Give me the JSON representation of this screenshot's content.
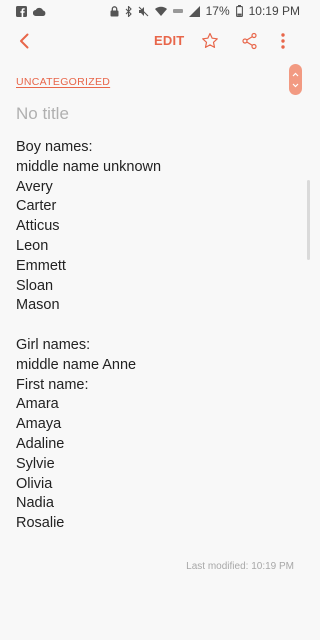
{
  "status_bar": {
    "battery": "17%",
    "time": "10:19 PM"
  },
  "toolbar": {
    "edit_label": "EDIT"
  },
  "note": {
    "category": "UNCATEGORIZED",
    "title_placeholder": "No title",
    "lines": [
      {
        "text": "Boy names:",
        "bold": true
      },
      {
        "text": "middle name unknown",
        "bold": true
      },
      {
        "text": "Avery",
        "bold": false
      },
      {
        "text": "Carter",
        "bold": false
      },
      {
        "text": "Atticus",
        "bold": false
      },
      {
        "text": "Leon",
        "bold": false
      },
      {
        "text": "Emmett",
        "bold": false
      },
      {
        "text": "Sloan",
        "bold": false
      },
      {
        "text": "Mason",
        "bold": false
      },
      {
        "text": "",
        "bold": false
      },
      {
        "text": "Girl names:",
        "bold": true
      },
      {
        "text": "middle name Anne",
        "bold": true
      },
      {
        "text": "First name:",
        "bold": true
      },
      {
        "text": "Amara",
        "bold": false
      },
      {
        "text": "Amaya",
        "bold": false
      },
      {
        "text": "Adaline",
        "bold": false
      },
      {
        "text": "Sylvie",
        "bold": false
      },
      {
        "text": "Olivia",
        "bold": false
      },
      {
        "text": "Nadia",
        "bold": false
      },
      {
        "text": "Rosalie",
        "bold": false
      }
    ],
    "last_modified": "Last modified: 10:19 PM"
  },
  "colors": {
    "accent": "#e8664a",
    "placeholder": "#b0b0b0",
    "background": "#f8f8f8"
  }
}
